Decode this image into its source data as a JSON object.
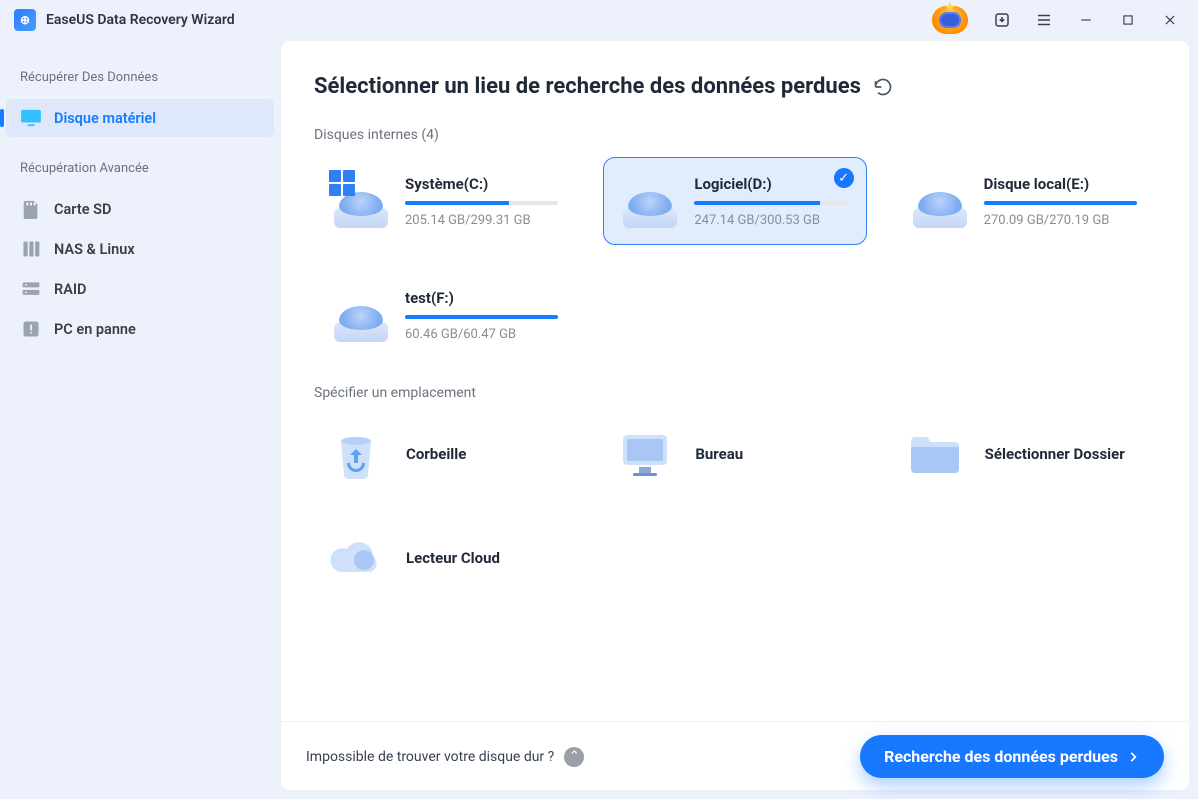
{
  "app": {
    "title": "EaseUS Data Recovery Wizard"
  },
  "titlebar_icons": [
    "update",
    "hamburger",
    "minimize",
    "maximize",
    "close"
  ],
  "sidebar": {
    "section1_title": "Récupérer Des Données",
    "section2_title": "Récupération Avancée",
    "items": [
      {
        "label": "Disque matériel",
        "icon": "monitor",
        "active": true
      },
      {
        "label": "Carte SD",
        "icon": "sdcard",
        "active": false
      },
      {
        "label": "NAS & Linux",
        "icon": "server",
        "active": false
      },
      {
        "label": "RAID",
        "icon": "raid",
        "active": false
      },
      {
        "label": "PC en panne",
        "icon": "alert",
        "active": false
      }
    ]
  },
  "main": {
    "title": "Sélectionner un lieu de recherche des données perdues",
    "internal_label_prefix": "Disques internes",
    "internal_count": 4,
    "disks": [
      {
        "name": "Système(C:)",
        "used_text": "205.14 GB/299.31 GB",
        "used_pct": 68,
        "selected": false,
        "os": true
      },
      {
        "name": "Logiciel(D:)",
        "used_text": "247.14 GB/300.53 GB",
        "used_pct": 82,
        "selected": true,
        "os": false
      },
      {
        "name": "Disque local(E:)",
        "used_text": "270.09 GB/270.19 GB",
        "used_pct": 100,
        "selected": false,
        "os": false
      },
      {
        "name": "test(F:)",
        "used_text": "60.46 GB/60.47 GB",
        "used_pct": 100,
        "selected": false,
        "os": false
      }
    ],
    "specify_label": "Spécifier un emplacement",
    "locations": [
      {
        "name": "Corbeille",
        "icon": "trash"
      },
      {
        "name": "Bureau",
        "icon": "desktop"
      },
      {
        "name": "Sélectionner Dossier",
        "icon": "folder"
      },
      {
        "name": "Lecteur Cloud",
        "icon": "cloud"
      }
    ]
  },
  "footer": {
    "help_text": "Impossible de trouver votre disque dur ?",
    "scan_label": "Recherche des données perdues"
  }
}
